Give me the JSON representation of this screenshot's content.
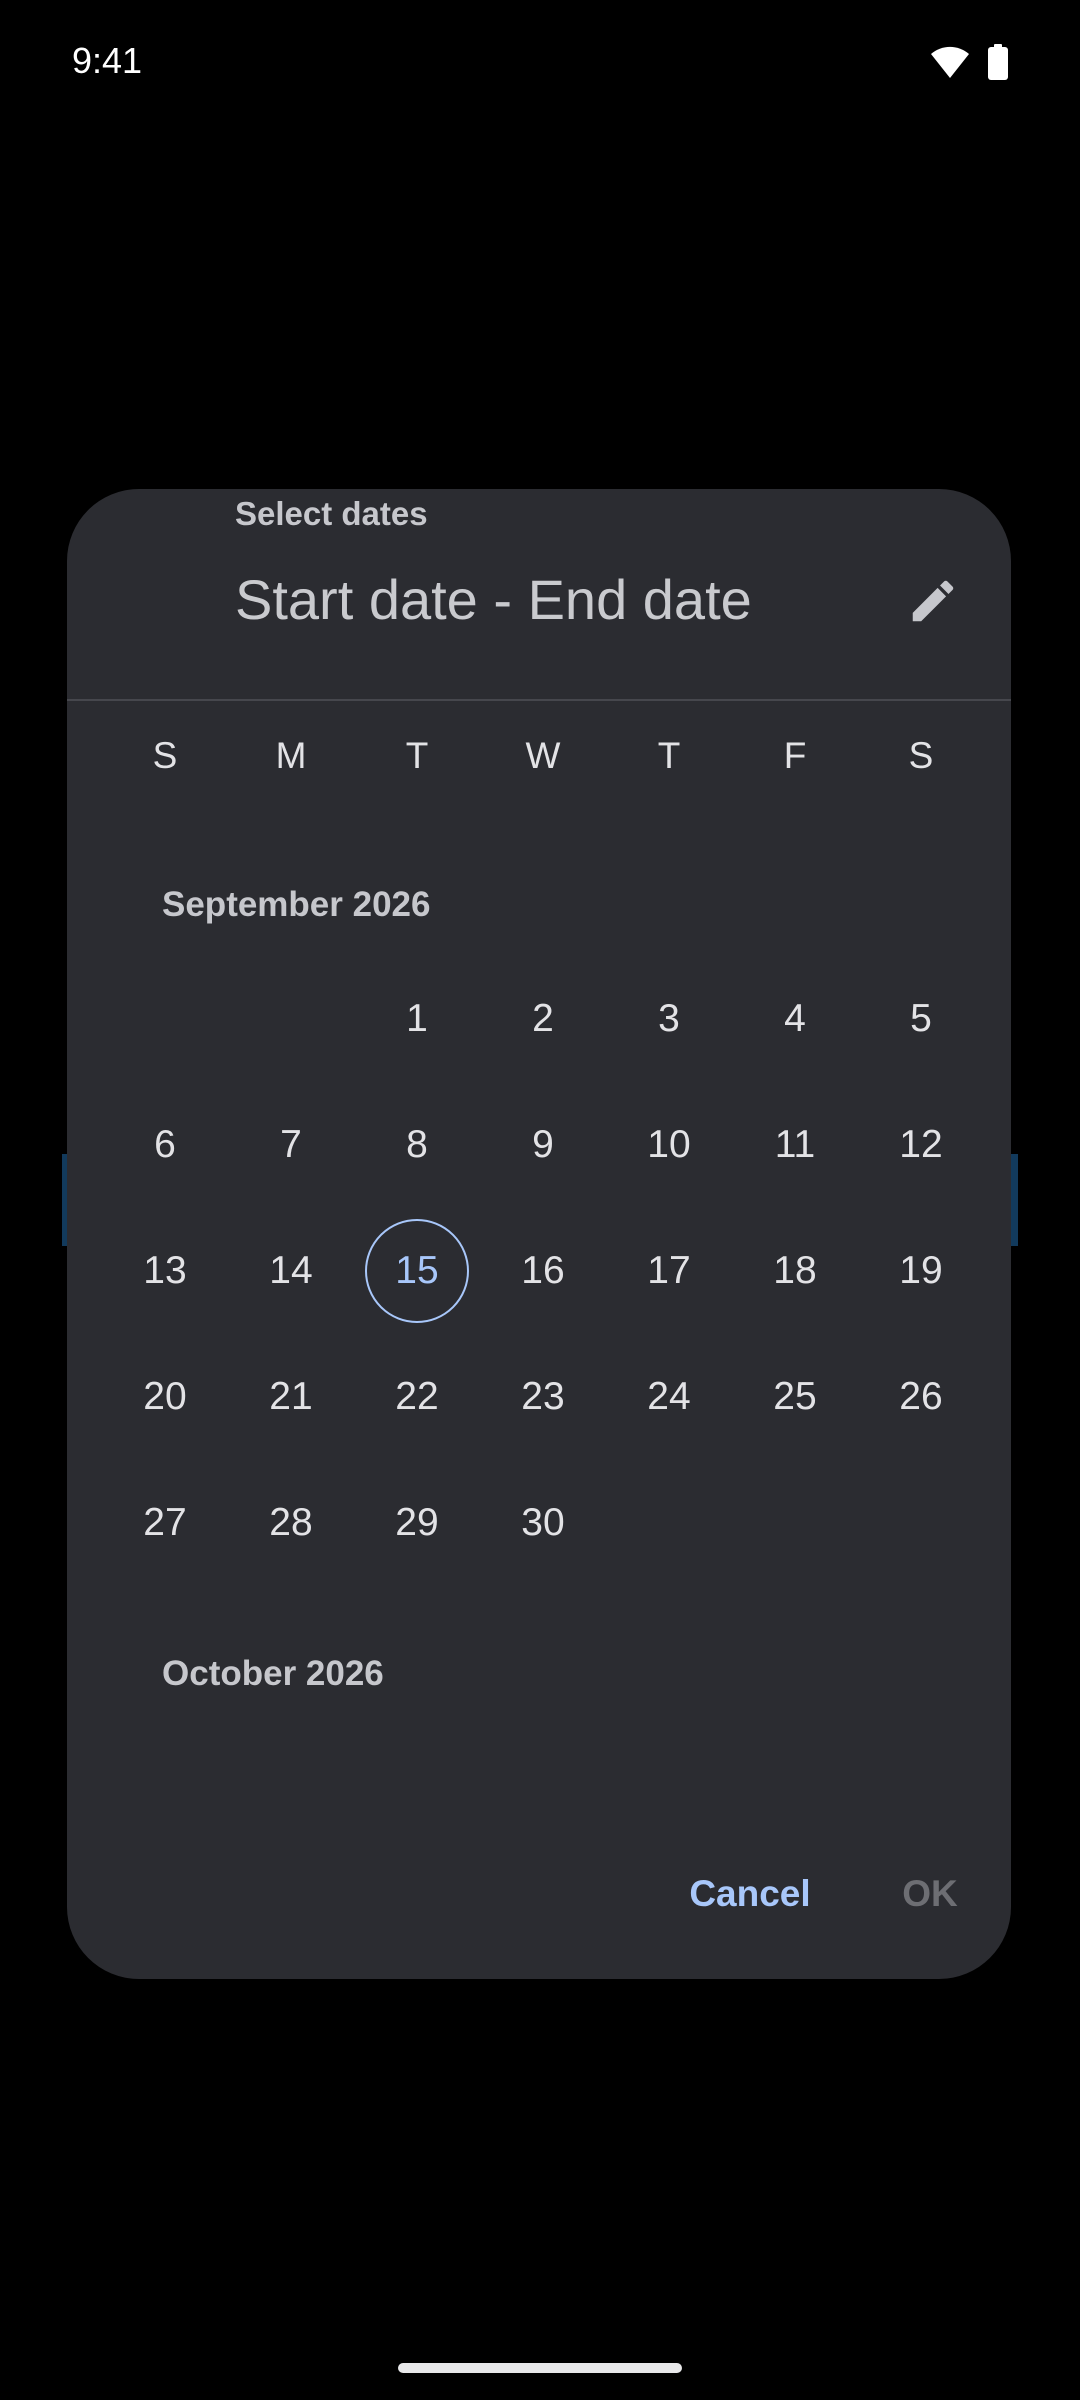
{
  "status_bar": {
    "time": "9:41",
    "icons": [
      "wifi-icon",
      "battery-icon"
    ]
  },
  "dialog": {
    "title": "Select dates",
    "headline": "Start date - End date",
    "edit_icon": "pencil-icon",
    "weekdays": [
      "S",
      "M",
      "T",
      "W",
      "T",
      "F",
      "S"
    ],
    "months": [
      {
        "label": "September 2026",
        "weeks": [
          [
            "",
            "",
            "1",
            "2",
            "3",
            "4",
            "5"
          ],
          [
            "6",
            "7",
            "8",
            "9",
            "10",
            "11",
            "12"
          ],
          [
            "13",
            "14",
            "15",
            "16",
            "17",
            "18",
            "19"
          ],
          [
            "20",
            "21",
            "22",
            "23",
            "24",
            "25",
            "26"
          ],
          [
            "27",
            "28",
            "29",
            "30",
            "",
            "",
            ""
          ]
        ],
        "today": "15"
      },
      {
        "label": "October 2026"
      }
    ],
    "cancel_label": "Cancel",
    "ok_label": "OK"
  },
  "colors": {
    "dialog_bg": "#2b2c31",
    "accent": "#a8c7fa",
    "disabled": "#6d6e73"
  }
}
